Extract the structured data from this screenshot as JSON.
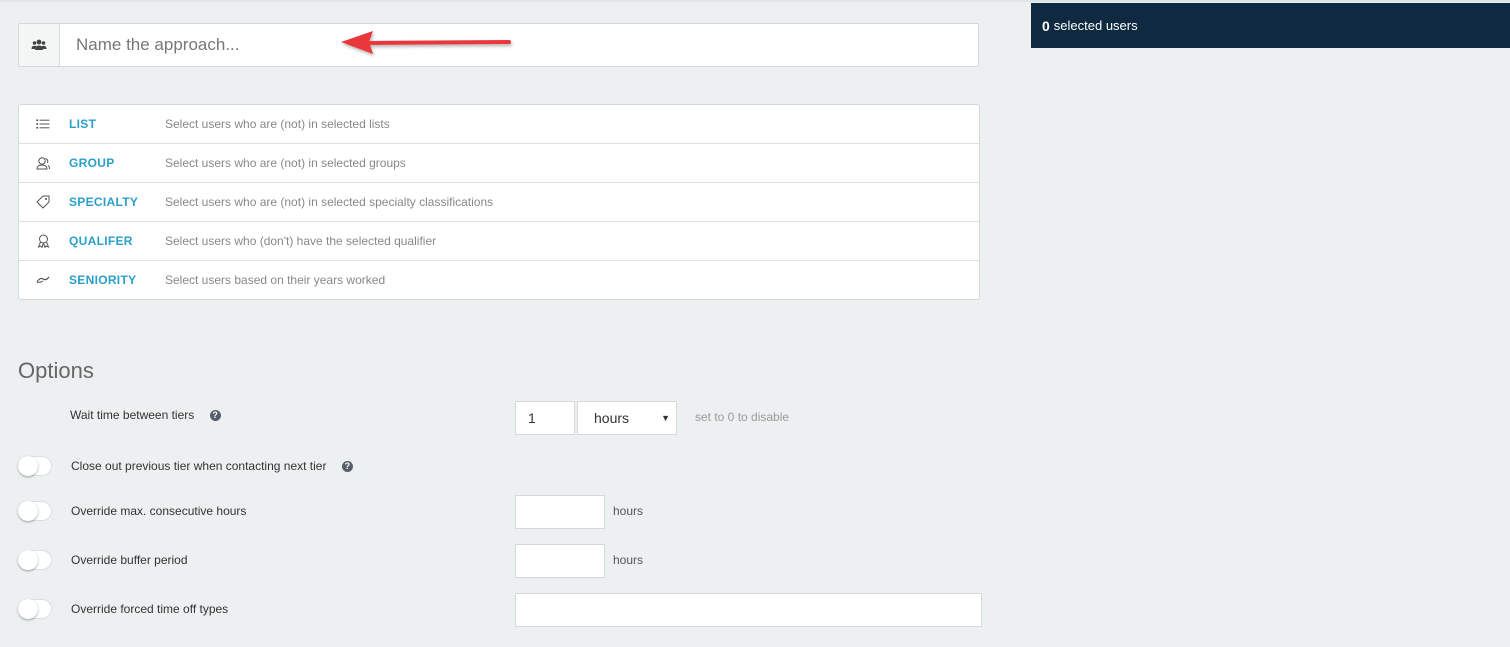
{
  "name_field": {
    "placeholder": "Name the approach...",
    "icon": "users-icon"
  },
  "selected_panel": {
    "count": "0",
    "label": "selected users"
  },
  "criteria": [
    {
      "icon": "list-icon",
      "title": "LIST",
      "desc": "Select users who are (not) in selected lists"
    },
    {
      "icon": "group-icon",
      "title": "GROUP",
      "desc": "Select users who are (not) in selected groups"
    },
    {
      "icon": "tag-icon",
      "title": "SPECIALTY",
      "desc": "Select users who are (not) in selected specialty classifications"
    },
    {
      "icon": "award-icon",
      "title": "QUALIFER",
      "desc": "Select users who (don't) have the selected qualifier"
    },
    {
      "icon": "seniority-icon",
      "title": "SENIORITY",
      "desc": "Select users based on their years worked"
    }
  ],
  "options": {
    "title": "Options",
    "wait_time": {
      "label": "Wait time between tiers",
      "value": "1",
      "unit_selected": "hours",
      "hint": "set to 0 to disable"
    },
    "close_out": {
      "label": "Close out previous tier when contacting next tier",
      "enabled": false
    },
    "max_consecutive": {
      "label": "Override max. consecutive hours",
      "value": "",
      "unit": "hours",
      "enabled": false
    },
    "buffer_period": {
      "label": "Override buffer period",
      "value": "",
      "unit": "hours",
      "enabled": false
    },
    "forced_time_off": {
      "label": "Override forced time off types",
      "value": "",
      "enabled": false
    }
  },
  "colors": {
    "accent": "#2b9fc9",
    "panel": "#0f2a40",
    "arrow": "#e8383b",
    "background": "#edf0f0"
  }
}
